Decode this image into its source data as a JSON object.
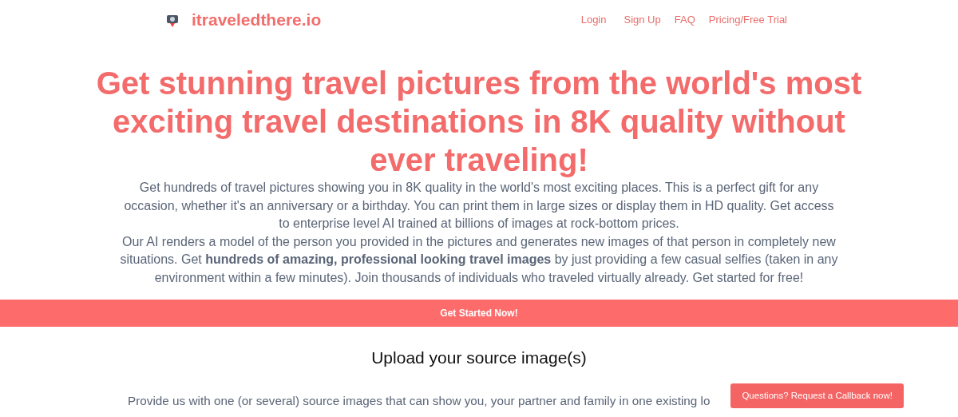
{
  "brand": {
    "name": "itraveledthere.io"
  },
  "nav": [
    {
      "label": "Login"
    },
    {
      "label": "Sign Up"
    },
    {
      "label": "FAQ"
    },
    {
      "label": "Pricing/Free Trial"
    }
  ],
  "hero": {
    "title": "Get stunning travel pictures from the world's most exciting travel destinations in 8K quality without ever traveling!",
    "paragraphs": [
      "Get hundreds of travel pictures showing you in 8K quality in the world's most exciting places. This is a perfect gift for any occasion, whether it's an anniversary or a birthday. You can print them in large sizes or display them in HD quality. Get access to enterprise level AI trained at billions of images at rock-bottom prices.",
      "Our AI renders a model of the person you provided in the pictures and generates new images of that person in completely new situations. Get **hundreds of amazing, professional looking travel images** by just providing a few casual selfies (taken in any environment within a few minutes). Join thousands of individuals who traveled virtually already. Get started for free!"
    ]
  },
  "cta": {
    "label": "Get Started Now!"
  },
  "upload": {
    "heading": "Upload your source image(s)",
    "text": "Provide us with one (or several) source images that can show you, your partner and family in one existing lo"
  },
  "callback": {
    "label": "Questions? Request a Callback now!"
  }
}
